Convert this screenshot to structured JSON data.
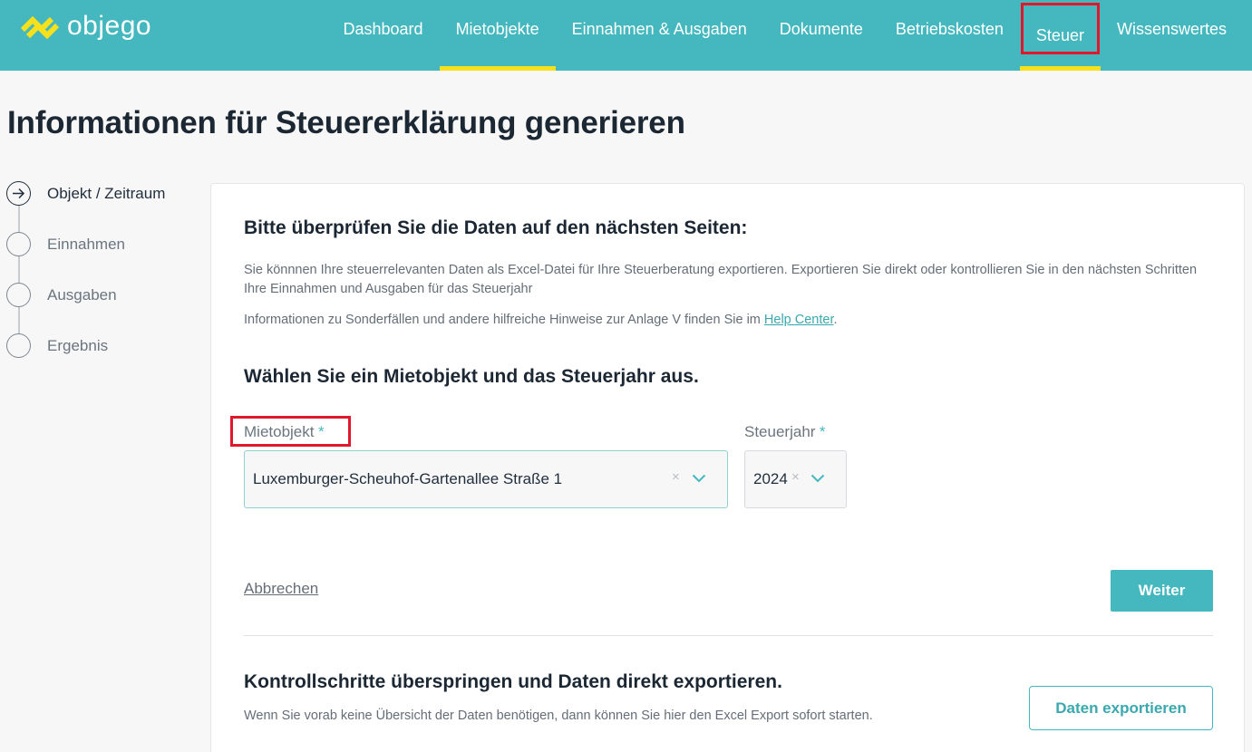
{
  "brand": {
    "name": "objego",
    "logo_color": "#f7e01c"
  },
  "nav": {
    "items": [
      {
        "label": "Dashboard"
      },
      {
        "label": "Mietobjekte"
      },
      {
        "label": "Einnahmen & Ausgaben"
      },
      {
        "label": "Dokumente"
      },
      {
        "label": "Betriebskosten"
      },
      {
        "label": "Steuer"
      },
      {
        "label": "Wissenswertes"
      }
    ],
    "active": [
      "Mietobjekte",
      "Steuer"
    ]
  },
  "page": {
    "title": "Informationen für Steuererklärung generieren"
  },
  "steps": [
    {
      "label": "Objekt / Zeitraum",
      "current": true,
      "icon": "arrow-right-circle-icon"
    },
    {
      "label": "Einnahmen"
    },
    {
      "label": "Ausgaben"
    },
    {
      "label": "Ergebnis"
    }
  ],
  "card": {
    "heading": "Bitte überprüfen Sie die Daten auf den nächsten Seiten:",
    "intro": "Sie könnnen Ihre steuerrelevanten Daten als Excel-Datei für Ihre Steuerberatung exportieren. Exportieren Sie direkt oder kontrollieren Sie in den nächsten Schritten Ihre Einnahmen und Ausgaben für das Steuerjahr",
    "info_prefix": "Informationen zu Sonderfällen und andere hilfreiche Hinweise zur Anlage V finden Sie im ",
    "info_link": "Help Center",
    "info_suffix": ".",
    "select_heading": "Wählen Sie ein Mietobjekt und das Steuerjahr aus.",
    "mietobjekt": {
      "label": "Mietobjekt",
      "required": "*",
      "value": "Luxemburger-Scheuhof-Gartenallee Straße 1",
      "clear": "×"
    },
    "steuerjahr": {
      "label": "Steuerjahr",
      "required": "*",
      "value": "2024",
      "clear": "×"
    },
    "cancel_label": "Abbrechen",
    "next_label": "Weiter",
    "skip_heading": "Kontrollschritte überspringen und Daten direkt exportieren.",
    "skip_text": "Wenn Sie vorab keine Übersicht der Daten benötigen, dann können Sie hier den Excel Export sofort starten.",
    "export_label": "Daten exportieren"
  },
  "colors": {
    "primary": "#45b8bf",
    "accent": "#f7e01c",
    "highlight": "#e0182b"
  }
}
